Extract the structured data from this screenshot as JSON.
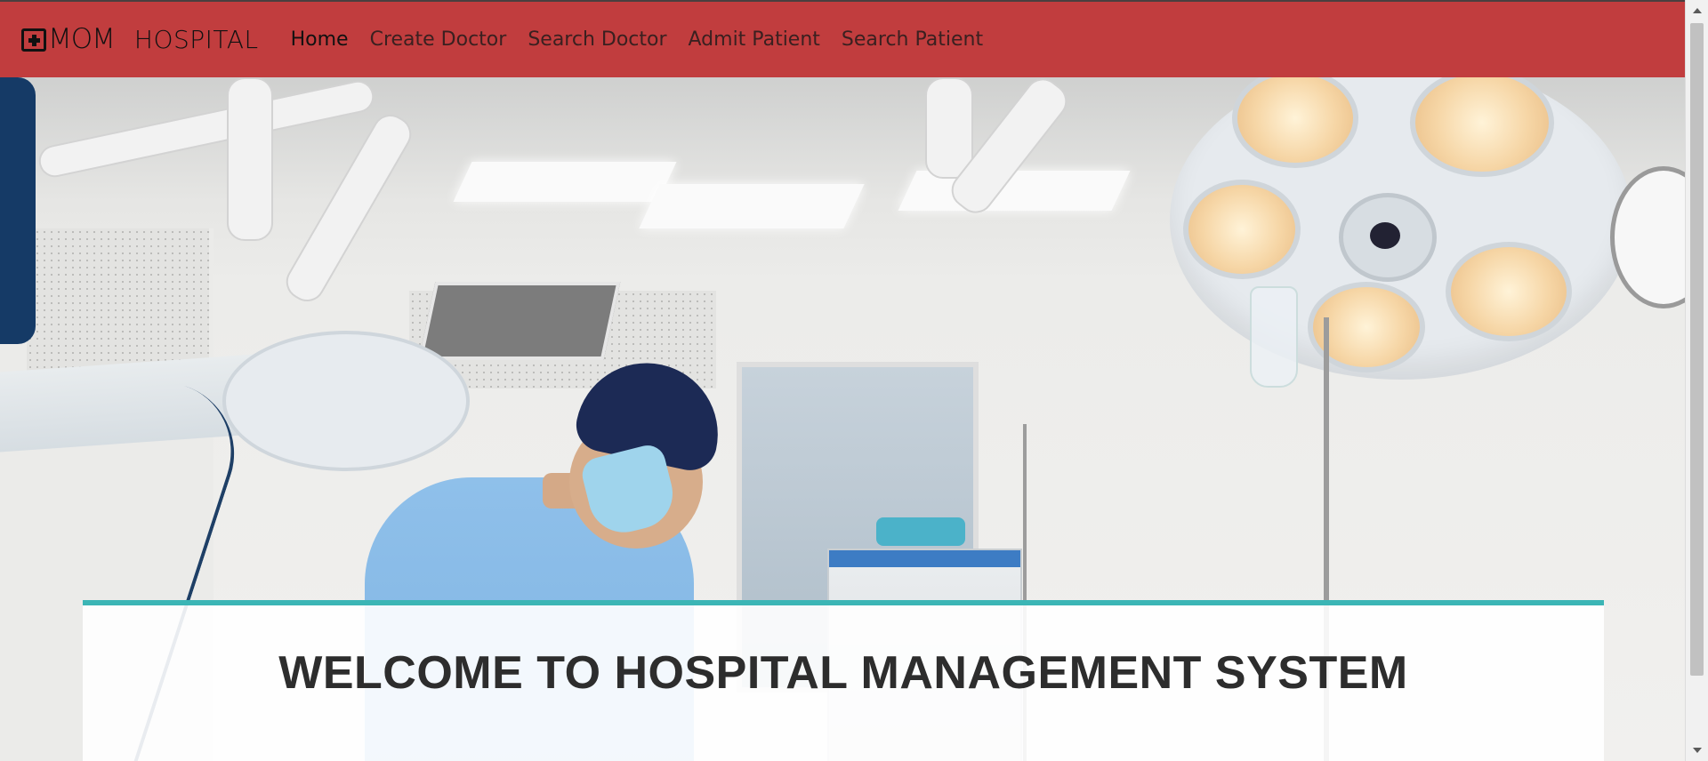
{
  "brand": {
    "logo_text": "MOM",
    "name": "HOSPITAL"
  },
  "nav": {
    "items": [
      {
        "label": "Home",
        "active": true
      },
      {
        "label": "Create Doctor",
        "active": false
      },
      {
        "label": "Search Doctor",
        "active": false
      },
      {
        "label": "Admit Patient",
        "active": false
      },
      {
        "label": "Search Patient",
        "active": false
      }
    ]
  },
  "hero": {
    "image": "operating-room-surgeon-photo",
    "welcome_title": "WELCOME TO HOSPITAL MANAGEMENT SYSTEM"
  },
  "colors": {
    "navbar_bg": "#c13d3e",
    "card_accent": "#3bb5b5",
    "title_text": "#2d2d2d"
  }
}
